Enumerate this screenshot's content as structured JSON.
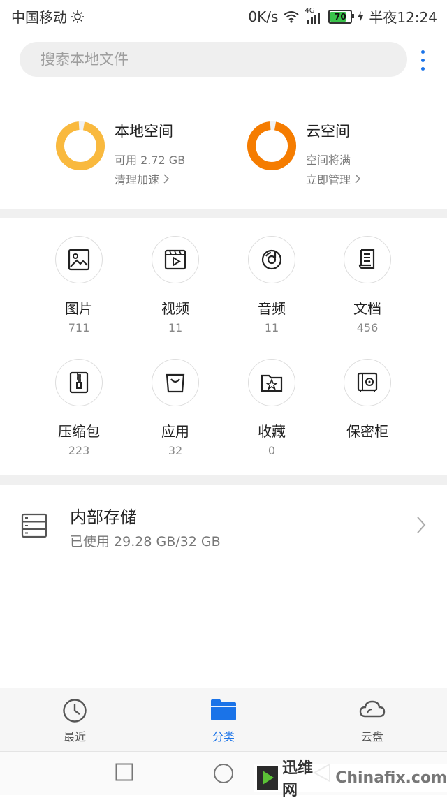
{
  "status_bar": {
    "carrier": "中国移动",
    "speed": "0K/s",
    "network": "4G",
    "battery": "70",
    "time": "半夜12:24"
  },
  "search": {
    "placeholder": "搜索本地文件"
  },
  "summary": {
    "local": {
      "title": "本地空间",
      "available": "可用 2.72 GB",
      "action": "清理加速",
      "ring_color": "#f9b93e",
      "used_fraction": 0.96
    },
    "cloud": {
      "title": "云空间",
      "status": "空间将满",
      "action": "立即管理",
      "ring_color": "#f57c00",
      "used_fraction": 0.96
    }
  },
  "categories": [
    {
      "label": "图片",
      "count": "711",
      "icon": "image-icon"
    },
    {
      "label": "视频",
      "count": "11",
      "icon": "video-icon"
    },
    {
      "label": "音频",
      "count": "11",
      "icon": "audio-icon"
    },
    {
      "label": "文档",
      "count": "456",
      "icon": "document-icon"
    },
    {
      "label": "压缩包",
      "count": "223",
      "icon": "archive-icon"
    },
    {
      "label": "应用",
      "count": "32",
      "icon": "app-icon"
    },
    {
      "label": "收藏",
      "count": "0",
      "icon": "favorite-icon"
    },
    {
      "label": "保密柜",
      "count": "",
      "icon": "safe-icon"
    }
  ],
  "internal_storage": {
    "title": "内部存储",
    "usage": "已使用 29.28 GB/32 GB"
  },
  "bottom_nav": [
    {
      "label": "最近",
      "icon": "clock-icon",
      "active": false
    },
    {
      "label": "分类",
      "icon": "folder-icon",
      "active": true
    },
    {
      "label": "云盘",
      "icon": "cloud-icon",
      "active": false
    }
  ],
  "colors": {
    "accent": "#1a73e8",
    "local_ring": "#f9b93e",
    "cloud_ring": "#f57c00"
  },
  "watermark": {
    "brand_cn": "迅维网",
    "brand_en": "Chinafix.com"
  }
}
